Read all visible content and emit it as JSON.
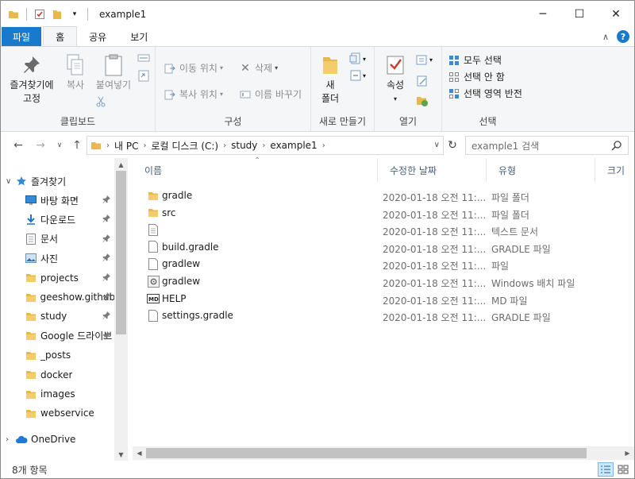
{
  "window": {
    "title": "example1",
    "controls": {
      "minimize": "─",
      "maximize": "☐",
      "close": "✕"
    }
  },
  "tabs": [
    {
      "label": "파일"
    },
    {
      "label": "홈"
    },
    {
      "label": "공유"
    },
    {
      "label": "보기"
    }
  ],
  "ribbon": {
    "clipboard": {
      "group_label": "클립보드",
      "pin_label_1": "즐겨찾기에",
      "pin_label_2": "고정",
      "copy": "복사",
      "paste": "붙여넣기"
    },
    "organize": {
      "group_label": "구성",
      "move_to": "이동 위치",
      "copy_to": "복사 위치",
      "delete": "삭제",
      "rename": "이름 바꾸기"
    },
    "new": {
      "group_label": "새로 만들기",
      "new_folder_1": "새",
      "new_folder_2": "폴더"
    },
    "open": {
      "group_label": "열기",
      "properties": "속성"
    },
    "select": {
      "group_label": "선택",
      "select_all": "모두 선택",
      "select_none": "선택 안 함",
      "invert": "선택 영역 반전"
    }
  },
  "address": {
    "crumbs": [
      "내 PC",
      "로컬 디스크 (C:)",
      "study",
      "example1"
    ],
    "search_placeholder": "example1 검색"
  },
  "nav": {
    "quick_access": "즐겨찾기",
    "items": [
      {
        "label": "바탕 화면",
        "icon": "desktop-icon",
        "pinned": true
      },
      {
        "label": "다운로드",
        "icon": "download-icon",
        "pinned": true
      },
      {
        "label": "문서",
        "icon": "document-icon",
        "pinned": true
      },
      {
        "label": "사진",
        "icon": "picture-icon",
        "pinned": true
      },
      {
        "label": "projects",
        "icon": "folder-icon",
        "pinned": true
      },
      {
        "label": "geeshow.github",
        "icon": "folder-icon",
        "pinned": true
      },
      {
        "label": "study",
        "icon": "folder-icon",
        "pinned": true
      },
      {
        "label": "Google 드라이브",
        "icon": "folder-icon",
        "pinned": true
      },
      {
        "label": "_posts",
        "icon": "folder-icon",
        "pinned": false
      },
      {
        "label": "docker",
        "icon": "folder-icon",
        "pinned": false
      },
      {
        "label": "images",
        "icon": "folder-icon",
        "pinned": false
      },
      {
        "label": "webservice",
        "icon": "folder-icon",
        "pinned": false
      }
    ],
    "onedrive": "OneDrive"
  },
  "columns": {
    "name": "이름",
    "date": "수정한 날짜",
    "type": "유형",
    "size": "크기"
  },
  "files": [
    {
      "name": "gradle",
      "date": "2020-01-18 오전 11:...",
      "type": "파일 폴더",
      "icon": "folder-icon"
    },
    {
      "name": "src",
      "date": "2020-01-18 오전 11:...",
      "type": "파일 폴더",
      "icon": "folder-icon"
    },
    {
      "name": "",
      "date": "2020-01-18 오전 11:...",
      "type": "텍스트 문서",
      "icon": "text-file-icon"
    },
    {
      "name": "build.gradle",
      "date": "2020-01-18 오전 11:...",
      "type": "GRADLE 파일",
      "icon": "file-icon"
    },
    {
      "name": "gradlew",
      "date": "2020-01-18 오전 11:...",
      "type": "파일",
      "icon": "file-icon"
    },
    {
      "name": "gradlew",
      "date": "2020-01-18 오전 11:...",
      "type": "Windows 배치 파일",
      "icon": "batch-file-icon"
    },
    {
      "name": "HELP",
      "date": "2020-01-18 오전 11:...",
      "type": "MD 파일",
      "icon": "md-file-icon"
    },
    {
      "name": "settings.gradle",
      "date": "2020-01-18 오전 11:...",
      "type": "GRADLE 파일",
      "icon": "file-icon"
    }
  ],
  "status": {
    "item_count": "8개 항목"
  },
  "colors": {
    "accent": "#1979ca",
    "folder": "#e8b84a",
    "ribbon_bg": "#f5f6f7"
  }
}
